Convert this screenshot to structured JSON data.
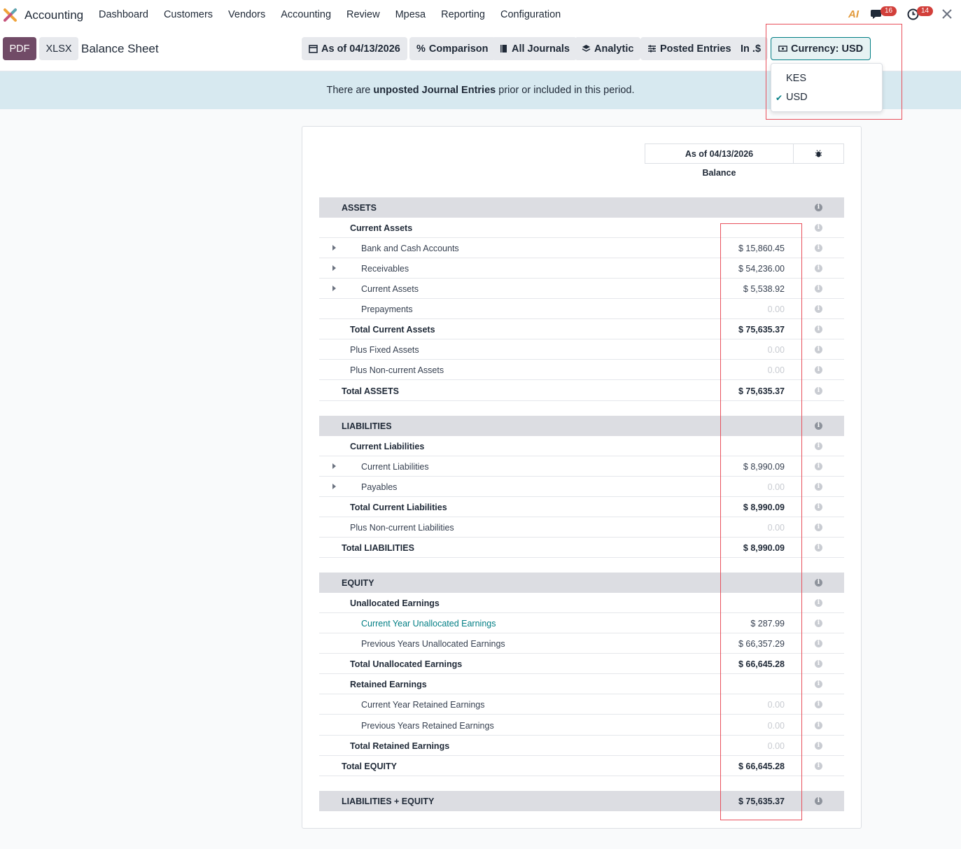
{
  "topnav": {
    "app_name": "Accounting",
    "menu": [
      "Dashboard",
      "Customers",
      "Vendors",
      "Accounting",
      "Review",
      "Mpesa",
      "Reporting",
      "Configuration"
    ],
    "ai_label": "AI",
    "messages_count": "16",
    "activities_count": "14"
  },
  "controls": {
    "pdf_label": "PDF",
    "xlsx_label": "XLSX",
    "report_title": "Balance Sheet",
    "filters": {
      "date": "As of 04/13/2026",
      "comparison": "Comparison",
      "journals": "All Journals",
      "analytic": "Analytic",
      "posted": "Posted Entries",
      "in": "In .$",
      "currency": "Currency: USD"
    }
  },
  "currency_dropdown": {
    "options": [
      "KES",
      "USD"
    ],
    "selected": "USD"
  },
  "banner": {
    "prefix": "There are ",
    "bold": "unposted Journal Entries",
    "suffix": " prior or included in this period."
  },
  "report": {
    "column_header": "As of 04/13/2026",
    "column_subheader": "Balance",
    "rows": [
      {
        "label": "ASSETS",
        "value": ""
      },
      {
        "label": "Current Assets",
        "value": ""
      },
      {
        "label": "Bank and Cash Accounts",
        "value": "$ 15,860.45"
      },
      {
        "label": "Receivables",
        "value": "$ 54,236.00"
      },
      {
        "label": "Current Assets",
        "value": "$ 5,538.92"
      },
      {
        "label": "Prepayments",
        "value": "0.00"
      },
      {
        "label": "Total Current Assets",
        "value": "$ 75,635.37"
      },
      {
        "label": "Plus Fixed Assets",
        "value": "0.00"
      },
      {
        "label": "Plus Non-current Assets",
        "value": "0.00"
      },
      {
        "label": "Total ASSETS",
        "value": "$ 75,635.37"
      },
      {
        "label": "LIABILITIES",
        "value": ""
      },
      {
        "label": "Current Liabilities",
        "value": ""
      },
      {
        "label": "Current Liabilities",
        "value": "$ 8,990.09"
      },
      {
        "label": "Payables",
        "value": "0.00"
      },
      {
        "label": "Total Current Liabilities",
        "value": "$ 8,990.09"
      },
      {
        "label": "Plus Non-current Liabilities",
        "value": "0.00"
      },
      {
        "label": "Total LIABILITIES",
        "value": "$ 8,990.09"
      },
      {
        "label": "EQUITY",
        "value": ""
      },
      {
        "label": "Unallocated Earnings",
        "value": ""
      },
      {
        "label": "Current Year Unallocated Earnings",
        "value": "$ 287.99"
      },
      {
        "label": "Previous Years Unallocated Earnings",
        "value": "$ 66,357.29"
      },
      {
        "label": "Total Unallocated Earnings",
        "value": "$ 66,645.28"
      },
      {
        "label": "Retained Earnings",
        "value": ""
      },
      {
        "label": "Current Year Retained Earnings",
        "value": "0.00"
      },
      {
        "label": "Previous Years Retained Earnings",
        "value": "0.00"
      },
      {
        "label": "Total Retained Earnings",
        "value": "0.00"
      },
      {
        "label": "Total EQUITY",
        "value": "$ 66,645.28"
      },
      {
        "label": "LIABILITIES + EQUITY",
        "value": "$ 75,635.37"
      }
    ]
  },
  "colors": {
    "brand": "#714b67",
    "accent": "#017e84",
    "banner_bg": "#d7e9f0",
    "highlight": "#e8505b"
  }
}
